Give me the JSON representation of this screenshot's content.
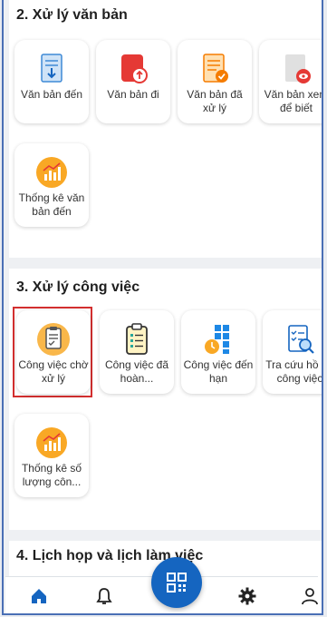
{
  "sections": [
    {
      "title": "2. Xử lý văn bản",
      "items": [
        {
          "label": "Văn bản đến",
          "icon": "incoming-document-icon"
        },
        {
          "label": "Văn bản đi",
          "icon": "outgoing-document-icon"
        },
        {
          "label": "Văn bản đã xử lý",
          "icon": "processed-document-icon"
        },
        {
          "label": "Văn bản xem để biết",
          "icon": "view-document-icon"
        },
        {
          "label": "Thống kê văn bản đến",
          "icon": "statistics-chart-icon"
        }
      ]
    },
    {
      "title": "3. Xử lý công việc",
      "items": [
        {
          "label": "Công việc chờ xử lý",
          "icon": "pending-tasks-icon",
          "selected": true
        },
        {
          "label": "Công việc đã hoàn...",
          "icon": "completed-tasks-icon"
        },
        {
          "label": "Công việc đến hạn",
          "icon": "due-tasks-icon"
        },
        {
          "label": "Tra cứu hồ sơ công việc",
          "icon": "search-records-icon"
        },
        {
          "label": "Thống kê số lượng côn...",
          "icon": "statistics-chart-icon"
        }
      ]
    },
    {
      "title": "4. Lịch họp và lịch làm việc"
    }
  ],
  "bottom_nav": {
    "items": [
      {
        "name": "home",
        "icon": "home-icon"
      },
      {
        "name": "notifications",
        "icon": "bell-icon"
      },
      {
        "name": "qr-scanner",
        "icon": "qr-code-icon"
      },
      {
        "name": "settings",
        "icon": "gear-icon"
      },
      {
        "name": "account",
        "icon": "user-icon"
      }
    ]
  },
  "colors": {
    "accent": "#1565c0",
    "selected_border": "#d32f2f",
    "frame_border": "#4a6fb5"
  }
}
